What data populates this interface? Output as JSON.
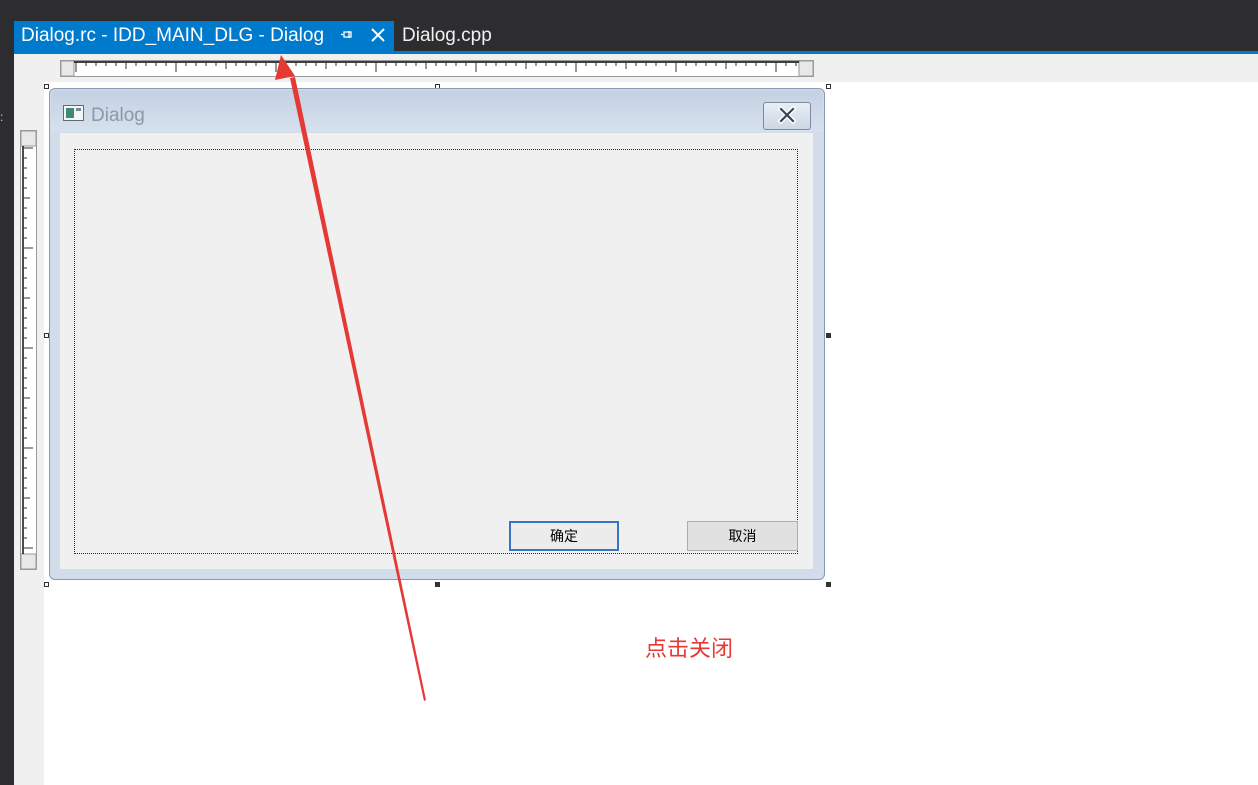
{
  "tabs": {
    "active": {
      "label": "Dialog.rc - IDD_MAIN_DLG - Dialog",
      "pin_icon": "pin-icon",
      "close_icon": "close-icon"
    },
    "inactive": {
      "label": "Dialog.cpp"
    }
  },
  "dialog": {
    "title": "Dialog",
    "icon": "dialog-icon",
    "close_icon": "close-x-icon",
    "buttons": {
      "ok": "确定",
      "cancel": "取消"
    }
  },
  "annotation": {
    "text": "点击关闭",
    "color": "#e53935"
  },
  "colors": {
    "accent": "#007acc",
    "ide_dark": "#2d2d30",
    "dialog_frame": "#d3dceb",
    "client_bg": "#f0f0f0"
  }
}
